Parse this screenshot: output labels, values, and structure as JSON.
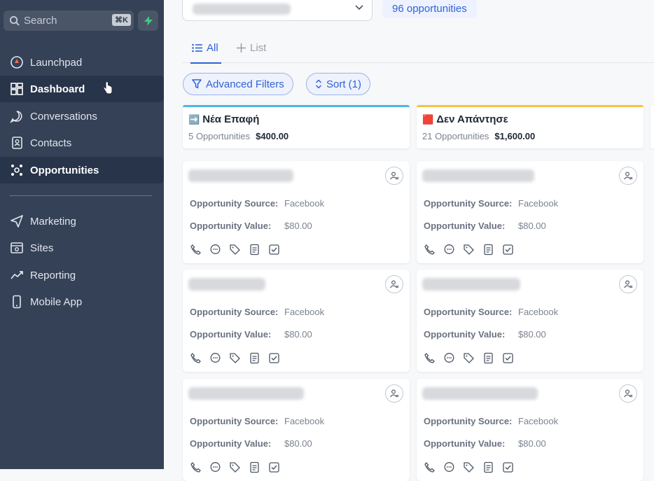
{
  "sidebar": {
    "search_placeholder": "Search",
    "search_shortcut": "⌘K",
    "items": [
      {
        "label": "Launchpad",
        "icon": "rocket-icon"
      },
      {
        "label": "Dashboard",
        "icon": "dashboard-icon"
      },
      {
        "label": "Conversations",
        "icon": "chat-icon"
      },
      {
        "label": "Contacts",
        "icon": "contacts-icon"
      },
      {
        "label": "Opportunities",
        "icon": "opportunities-icon"
      },
      {
        "label": "Marketing",
        "icon": "send-icon"
      },
      {
        "label": "Sites",
        "icon": "sites-icon"
      },
      {
        "label": "Reporting",
        "icon": "chart-icon"
      },
      {
        "label": "Mobile App",
        "icon": "phone-icon"
      }
    ],
    "active": "Opportunities",
    "hover": "Dashboard"
  },
  "header": {
    "opportunity_count": "96 opportunities"
  },
  "tabs": [
    {
      "label": "All"
    },
    {
      "label": "List"
    }
  ],
  "toolbar": {
    "advanced_filters": "Advanced Filters",
    "sort": "Sort (1)"
  },
  "columns": [
    {
      "emoji": "➡️",
      "title": "Νέα Επαφή",
      "count": "5 Opportunities",
      "value": "$400.00",
      "accent": "#4cb6e6"
    },
    {
      "emoji": "🟥",
      "title": "Δεν Απάντησε",
      "count": "21 Opportunities",
      "value": "$1,600.00",
      "accent": "#f5c242"
    }
  ],
  "card_fields": {
    "source_label": "Opportunity Source:",
    "value_label": "Opportunity Value:"
  },
  "cards": [
    {
      "source": "Facebook",
      "value": "$80.00"
    },
    {
      "source": "Facebook",
      "value": "$80.00"
    },
    {
      "source": "Facebook",
      "value": "$80.00"
    },
    {
      "source": "Facebook",
      "value": "$80.00"
    },
    {
      "source": "Facebook",
      "value": "$80.00"
    },
    {
      "source": "Facebook",
      "value": "$80.00"
    }
  ],
  "colors": {
    "sidebar": "#344157",
    "accent": "#2f62d8"
  }
}
